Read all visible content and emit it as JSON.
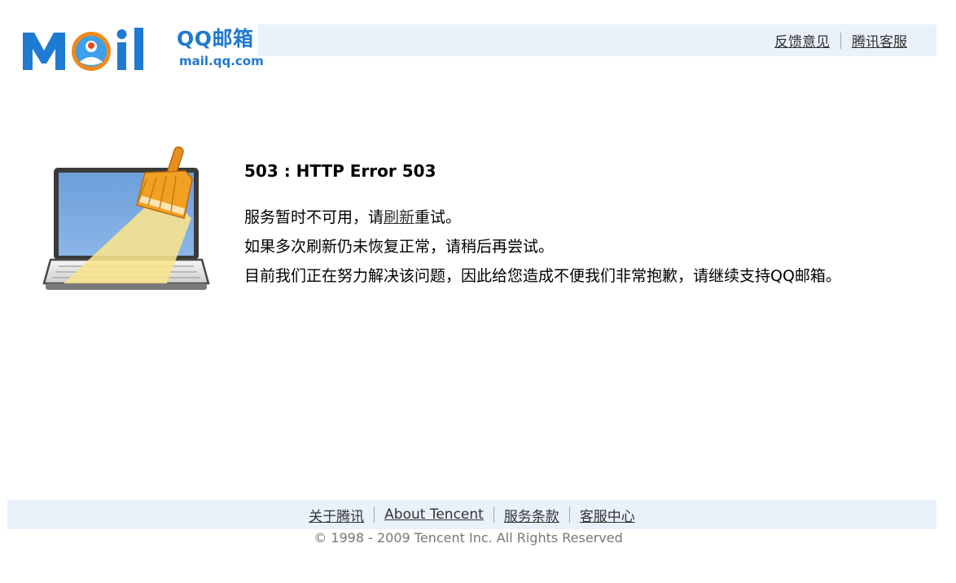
{
  "header": {
    "logo_word": "Mail",
    "logo_brand": "QQ邮箱",
    "logo_domain": "mail.qq.com",
    "links": [
      "反馈意见",
      "腾讯客服"
    ]
  },
  "main": {
    "title": "503 : HTTP Error 503",
    "line1_before": "服务暂时不可用，请",
    "line1_link": "刷新",
    "line1_after": "重试。",
    "line2": "如果多次刷新仍未恢复正常，请稍后再尝试。",
    "line3": "目前我们正在努力解决该问题，因此给您造成不便我们非常抱歉，请继续支持QQ邮箱。"
  },
  "footer": {
    "links": [
      "关于腾讯",
      "About Tencent",
      "服务条款",
      "客服中心"
    ],
    "copyright": "© 1998 - 2009 Tencent Inc. All Rights Reserved"
  },
  "colors": {
    "brand_blue": "#1f7ad1",
    "bar_bg": "#e9f1fb",
    "logo_orange": "#f08a1c"
  },
  "icons": [
    "mail-logo-icon",
    "laptop-broom-icon"
  ]
}
